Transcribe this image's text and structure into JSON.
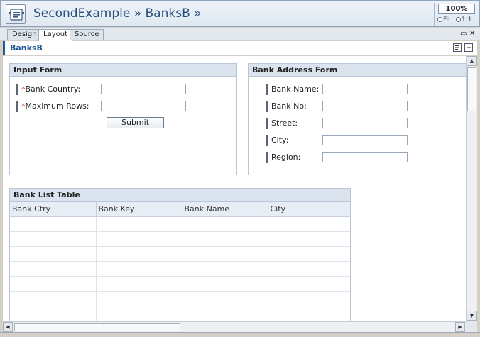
{
  "window": {
    "title": "SecondExample » BanksB »",
    "zoom": "100%",
    "zoom_fit": "Fit",
    "zoom_actual": "1:1"
  },
  "tabs": [
    {
      "label": "Design",
      "active": false
    },
    {
      "label": "Layout",
      "active": true
    },
    {
      "label": "Source",
      "active": false
    }
  ],
  "breadcrumb": "BanksB",
  "input_form": {
    "title": "Input Form",
    "fields": [
      {
        "label": "Bank Country:",
        "required": "*",
        "value": ""
      },
      {
        "label": "Maximum Rows:",
        "required": "*",
        "value": ""
      }
    ],
    "submit_label": "Submit"
  },
  "address_form": {
    "title": "Bank Address Form",
    "fields": [
      {
        "label": "Bank Name:",
        "value": ""
      },
      {
        "label": "Bank No:",
        "value": ""
      },
      {
        "label": "Street:",
        "value": ""
      },
      {
        "label": "City:",
        "value": ""
      },
      {
        "label": "Region:",
        "value": ""
      }
    ]
  },
  "bank_table": {
    "title": "Bank List Table",
    "columns": [
      "Bank Ctry",
      "Bank Key",
      "Bank Name",
      "City"
    ]
  },
  "colors": {
    "accent": "#1f5a94",
    "panel_header": "#dae3ee",
    "required": "#c0282e"
  }
}
